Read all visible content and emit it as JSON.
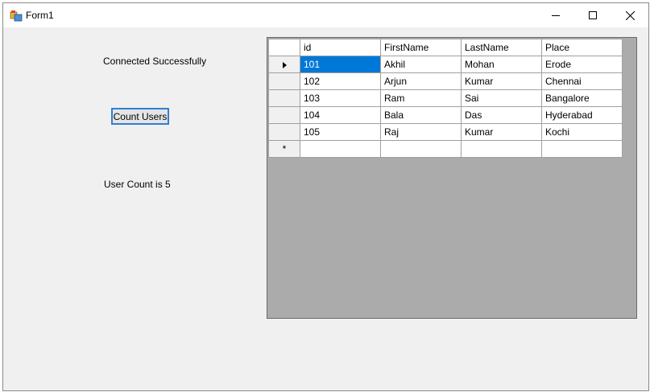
{
  "window": {
    "title": "Form1"
  },
  "labels": {
    "status": "Connected Successfully",
    "count": "User Count is 5"
  },
  "button": {
    "count_users": "Count Users"
  },
  "grid": {
    "columns": [
      "id",
      "FirstName",
      "LastName",
      "Place"
    ],
    "rows": [
      [
        "101",
        "Akhil",
        "Mohan",
        "Erode"
      ],
      [
        "102",
        "Arjun",
        "Kumar",
        "Chennai"
      ],
      [
        "103",
        "Ram",
        "Sai",
        "Bangalore"
      ],
      [
        "104",
        "Bala",
        "Das",
        "Hyderabad"
      ],
      [
        "105",
        "Raj",
        "Kumar",
        "Kochi"
      ]
    ],
    "new_row_marker": "*",
    "selected": {
      "row": 0,
      "col": 0
    }
  },
  "colors": {
    "selection": "#0078d7",
    "grid_background": "#ababab",
    "focus_border": "#2f7fd4"
  }
}
